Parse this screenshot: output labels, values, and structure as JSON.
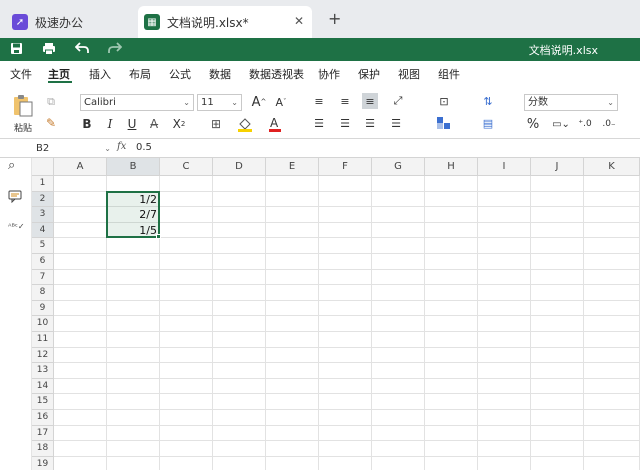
{
  "tabs": [
    {
      "label": "极速办公",
      "icon": "rocket-icon"
    },
    {
      "label": "文档说明.xlsx*",
      "icon": "spreadsheet-icon"
    }
  ],
  "quickbar": {
    "title": "文档说明.xlsx"
  },
  "menu": [
    "文件",
    "主页",
    "插入",
    "布局",
    "公式",
    "数据",
    "数据透视表",
    "协作",
    "保护",
    "视图",
    "组件"
  ],
  "ribbon": {
    "paste_label": "粘贴",
    "font": "Calibri",
    "size": "11",
    "number_format": "分数"
  },
  "formula": {
    "cell": "B2",
    "fx": "fx",
    "value": "0.5"
  },
  "columns": [
    "A",
    "B",
    "C",
    "D",
    "E",
    "F",
    "G",
    "H",
    "I",
    "J",
    "K"
  ],
  "rows": [
    "1",
    "2",
    "3",
    "4",
    "5",
    "6",
    "7",
    "8",
    "9",
    "10",
    "11",
    "12",
    "13",
    "14",
    "15",
    "16",
    "17",
    "18",
    "19"
  ],
  "cells": [
    {
      "ref": "B2",
      "value": "1/2"
    },
    {
      "ref": "B3",
      "value": "2/7"
    },
    {
      "ref": "B4",
      "value": "1/5"
    }
  ],
  "colors": {
    "accent": "#1e7145",
    "tab_bg": "#e9ebee",
    "header_bg": "#f3f3f3",
    "selected_header": "#dfe3e6"
  }
}
